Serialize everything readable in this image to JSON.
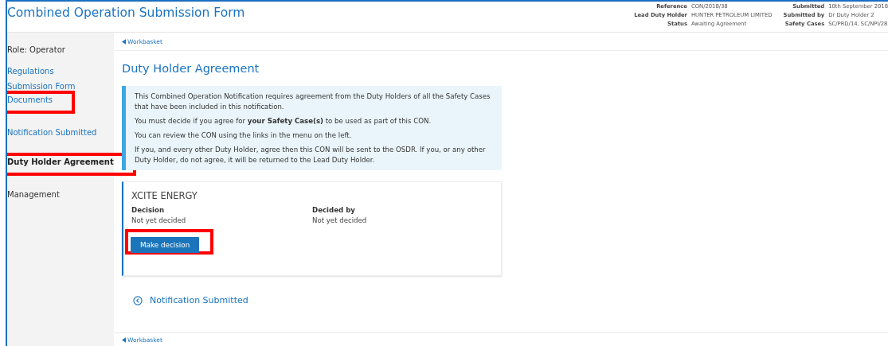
{
  "header": {
    "title": "Combined Operation Submission Form",
    "details_left": [
      {
        "label": "Reference",
        "value": "CON/2018/38"
      },
      {
        "label": "Lead Duty Holder",
        "value": "HUNTER PETROLEUM LIMITED"
      },
      {
        "label": "Status",
        "value": "Awaiting Agreement"
      }
    ],
    "details_right": [
      {
        "label": "Submitted",
        "value": "10th September 2018"
      },
      {
        "label": "Submitted by",
        "value": "Dr Duty Holder 2"
      },
      {
        "label": "Safety Cases",
        "value": "SC/PRD/14, SC/NPI/28"
      }
    ]
  },
  "sidebar": {
    "role": "Role: Operator",
    "items": [
      {
        "label": "Regulations",
        "kind": "link",
        "selected": false,
        "highlighted": false
      },
      {
        "label": "Submission Form",
        "kind": "link",
        "selected": false,
        "highlighted": false
      },
      {
        "label": "Documents",
        "kind": "link",
        "selected": false,
        "highlighted": true
      },
      {
        "label": "Notification Submitted",
        "kind": "link",
        "selected": false,
        "highlighted": false
      },
      {
        "label": "Duty Holder Agreement",
        "kind": "link",
        "selected": true,
        "highlighted": true
      },
      {
        "label": "Management",
        "kind": "label",
        "selected": false,
        "highlighted": false
      }
    ]
  },
  "breadcrumb": "Workbasket",
  "heading": "Duty Holder Agreement",
  "info": [
    "This Combined Operation Notification requires agreement from the Duty Holders of all the Safety Cases that have been included in this notification.",
    "You must decide if you agree for **your Safety Case(s)** to be used as part of this CON.",
    "You can review the CON using the links in the menu on the left.",
    "If you, and every other Duty Holder, agree then this CON will be sent to the OSDR. If you, or any other Duty Holder, do not agree, it will be returned to the Lead Duty Holder."
  ],
  "company": {
    "name": "XCITE ENERGY",
    "fields": [
      {
        "label": "Decision",
        "value": "Not yet decided"
      },
      {
        "label": "Decided by",
        "value": "Not yet decided"
      }
    ],
    "button": {
      "label": "Make decision",
      "highlighted": true
    }
  },
  "back_link": "Notification Submitted",
  "footer_breadcrumb": "Workbasket"
}
